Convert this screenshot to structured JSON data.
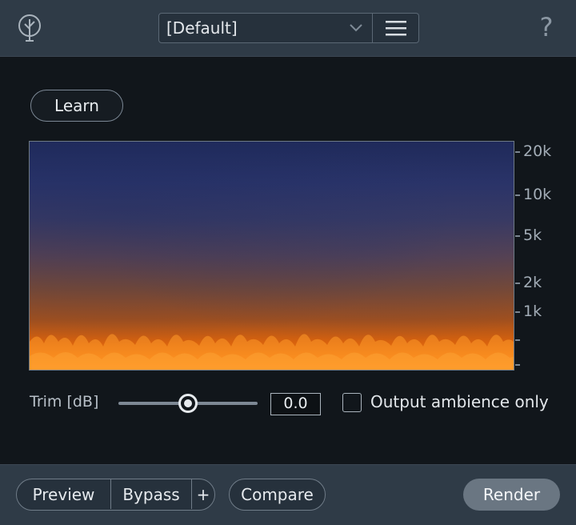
{
  "header": {
    "preset_value": "[Default]",
    "help_label": "?",
    "icons": [
      "tree-logo-icon",
      "chevron-down-icon",
      "hamburger-menu-icon",
      "help-icon"
    ]
  },
  "learn_label": "Learn",
  "spectrum": {
    "freq_labels": [
      "20k",
      "10k",
      "5k",
      "2k",
      "1k"
    ]
  },
  "trim": {
    "label": "Trim [dB]",
    "value": "0.0",
    "slider_fraction": 0.5
  },
  "output_ambience": {
    "label": "Output ambience only",
    "checked": false
  },
  "footer": {
    "preview_label": "Preview",
    "bypass_label": "Bypass",
    "plus_label": "+",
    "compare_label": "Compare",
    "render_label": "Render"
  },
  "colors": {
    "accent_orange": "#ff8a1a",
    "panel_bg": "#2f3b47",
    "main_bg": "#11161b"
  }
}
